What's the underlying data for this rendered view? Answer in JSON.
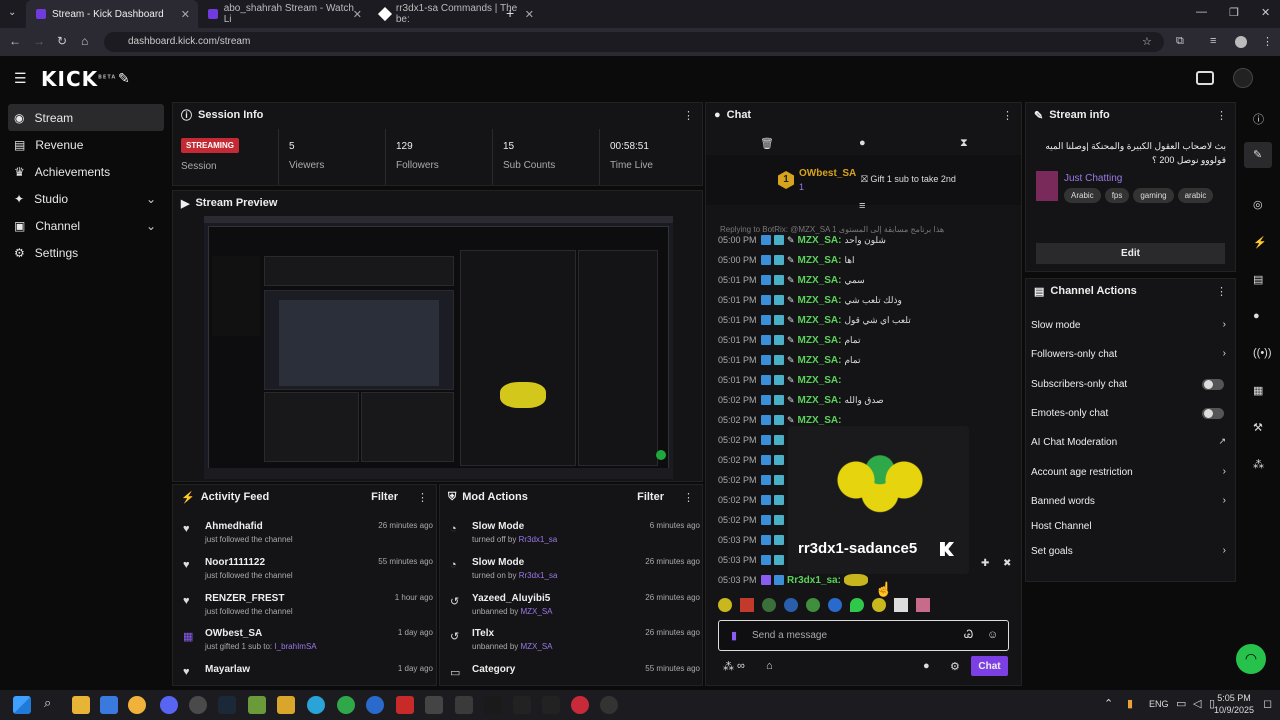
{
  "browser": {
    "tabs": [
      {
        "label": "Stream - Kick Dashboard"
      },
      {
        "label": "abo_shahrah Stream - Watch Li"
      },
      {
        "label": "rr3dx1-sa Commands | The be:"
      }
    ],
    "url": "dashboard.kick.com/stream"
  },
  "nav": {
    "items": [
      {
        "label": "Stream"
      },
      {
        "label": "Revenue"
      },
      {
        "label": "Achievements"
      },
      {
        "label": "Studio"
      },
      {
        "label": "Channel"
      },
      {
        "label": "Settings"
      }
    ]
  },
  "brand": {
    "logo": "KICK",
    "beta": "BETA"
  },
  "session": {
    "title": "Session Info",
    "status": "STREAMING",
    "status_label": "Session",
    "stats": [
      {
        "value": "5",
        "label": "Viewers"
      },
      {
        "value": "129",
        "label": "Followers"
      },
      {
        "value": "15",
        "label": "Sub Counts"
      },
      {
        "value": "00:58:51",
        "label": "Time Live"
      }
    ]
  },
  "preview": {
    "title": "Stream Preview"
  },
  "activity": {
    "title": "Activity Feed",
    "filter": "Filter",
    "items": [
      {
        "name": "Ahmedhafid",
        "sub": "just followed the channel",
        "time": "26 minutes ago"
      },
      {
        "name": "Noor1111122",
        "sub": "just followed the channel",
        "time": "55 minutes ago"
      },
      {
        "name": "RENZER_FREST",
        "sub": "just followed the channel",
        "time": "1 hour ago"
      },
      {
        "name": "OWbest_SA",
        "sub": "just gifted 1 sub to:",
        "target": "I_brahImSA",
        "time": "1 day ago"
      },
      {
        "name": "Mayarlaw",
        "sub": "",
        "time": "1 day ago"
      }
    ]
  },
  "mod": {
    "title": "Mod Actions",
    "filter": "Filter",
    "items": [
      {
        "name": "Slow Mode",
        "sub": "turned off by",
        "by": "Rr3dx1_sa",
        "time": "6 minutes ago"
      },
      {
        "name": "Slow Mode",
        "sub": "turned on by",
        "by": "Rr3dx1_sa",
        "time": "26 minutes ago"
      },
      {
        "name": "Yazeed_Aluyibi5",
        "sub": "unbanned by",
        "by": "MZX_SA",
        "time": "26 minutes ago"
      },
      {
        "name": "ITelx",
        "sub": "unbanned by",
        "by": "MZX_SA",
        "time": "26 minutes ago"
      },
      {
        "name": "Category",
        "sub": "",
        "by": "",
        "time": "55 minutes ago"
      }
    ]
  },
  "chat": {
    "title": "Chat",
    "gifter": "OWbest_SA",
    "gifter_count": "1",
    "gift_text": "Gift 1 sub to take 2nd",
    "reply_text": "Replying to BotRix: @MZX_SA 1 هذا برنامج مسابقة إلى المستوى",
    "messages": [
      {
        "time": "05:00 PM",
        "name": "MZX_SA:",
        "text": "شلون واحد"
      },
      {
        "time": "05:00 PM",
        "name": "MZX_SA:",
        "text": "اها"
      },
      {
        "time": "05:01 PM",
        "name": "MZX_SA:",
        "text": "سمي"
      },
      {
        "time": "05:01 PM",
        "name": "MZX_SA:",
        "text": "وذلك تلعب شي"
      },
      {
        "time": "05:01 PM",
        "name": "MZX_SA:",
        "text": "تلعب اي شي قول"
      },
      {
        "time": "05:01 PM",
        "name": "MZX_SA:",
        "text": "تمام"
      },
      {
        "time": "05:01 PM",
        "name": "MZX_SA:",
        "text": "تمام"
      },
      {
        "time": "05:01 PM",
        "name": "MZX_SA:",
        "text": ""
      },
      {
        "time": "05:02 PM",
        "name": "MZX_SA:",
        "text": "صدق والله"
      },
      {
        "time": "05:02 PM",
        "name": "MZX_SA:",
        "text": ""
      },
      {
        "time": "05:02 PM",
        "name": "",
        "text": ""
      },
      {
        "time": "05:02 PM",
        "name": "",
        "text": ""
      },
      {
        "time": "05:02 PM",
        "name": "",
        "text": ""
      },
      {
        "time": "05:02 PM",
        "name": "",
        "text": ""
      },
      {
        "time": "05:02 PM",
        "name": "",
        "text": ""
      },
      {
        "time": "05:03 PM",
        "name": "",
        "text": ""
      },
      {
        "time": "05:03 PM",
        "name": "",
        "text": ""
      }
    ],
    "last": {
      "time": "05:03 PM",
      "name": "Rr3dx1_sa:"
    },
    "emote_name": "rr3dx1-sadance5",
    "placeholder": "Send a message",
    "send": "Chat"
  },
  "streaminfo": {
    "title": "Stream info",
    "stream_title": "بث لاصحاب العقول الكبيرة والمحنكة |وصلنا الميه فولووو نوصل 200 ؟",
    "category": "Just Chatting",
    "tags": [
      "Arabic",
      "fps",
      "gaming",
      "arabic"
    ],
    "edit": "Edit"
  },
  "actions": {
    "title": "Channel Actions",
    "items": [
      {
        "label": "Slow mode",
        "kind": "arrow"
      },
      {
        "label": "Followers-only chat",
        "kind": "arrow"
      },
      {
        "label": "Subscribers-only chat",
        "kind": "toggle"
      },
      {
        "label": "Emotes-only chat",
        "kind": "toggle"
      },
      {
        "label": "AI Chat Moderation",
        "kind": "ext"
      },
      {
        "label": "Account age restriction",
        "kind": "arrow"
      },
      {
        "label": "Banned words",
        "kind": "arrow"
      },
      {
        "label": "Host Channel",
        "kind": "none"
      },
      {
        "label": "Set goals",
        "kind": "arrow"
      }
    ]
  },
  "taskbar": {
    "time": "5:05 PM",
    "date": "10/9/2025",
    "lang": "ENG"
  },
  "colors": {
    "accent": "#7b3fe4",
    "kick_green": "#53fc18",
    "streaming": "#c32a34"
  }
}
